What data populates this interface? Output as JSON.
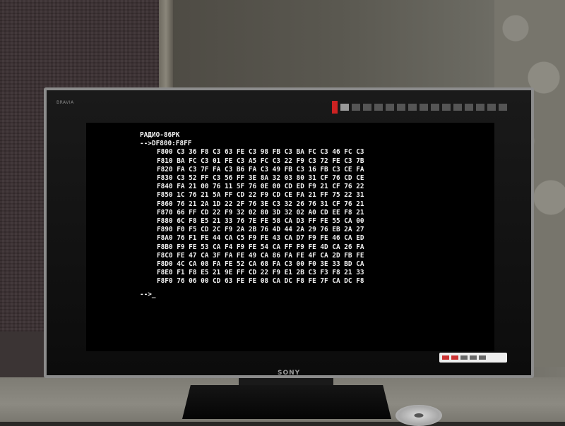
{
  "tv": {
    "brand_bezel": "BRAVIA",
    "logo": "SONY"
  },
  "terminal": {
    "title": "РАДИО-86РК",
    "command": "-->DF800:F8FF",
    "rows": [
      "F800 C3 36 F8 C3 63 FE C3 98 FB C3 BA FC C3 46 FC C3",
      "F810 BA FC C3 01 FE C3 A5 FC C3 22 F9 C3 72 FE C3 7B",
      "F820 FA C3 7F FA C3 B6 FA C3 49 FB C3 16 FB C3 CE FA",
      "F830 C3 52 FF C3 56 FF 3E 8A 32 03 80 31 CF 76 CD CE",
      "F840 FA 21 00 76 11 5F 76 0E 00 CD ED F9 21 CF 76 22",
      "F850 1C 76 21 5A FF CD 22 F9 CD CE FA 21 FF 75 22 31",
      "F860 76 21 2A 1D 22 2F 76 3E C3 32 26 76 31 CF 76 21",
      "F870 66 FF CD 22 F9 32 02 80 3D 32 02 A0 CD EE F8 21",
      "F880 6C F8 E5 21 33 76 7E FE 58 CA D3 FF FE 55 CA 00",
      "F890 F0 F5 CD 2C F9 2A 2B 76 4D 44 2A 29 76 EB 2A 27",
      "F8A0 76 F1 FE 44 CA C5 F9 FE 43 CA D7 F9 FE 46 CA ED",
      "F8B0 F9 FE 53 CA F4 F9 FE 54 CA FF F9 FE 4D CA 26 FA",
      "F8C0 FE 47 CA 3F FA FE 49 CA 86 FA FE 4F CA 2D FB FE",
      "F8D0 4C CA 08 FA FE 52 CA 68 FA C3 00 F0 3E 33 BD CA",
      "F8E0 F1 F8 E5 21 9E FF CD 22 F9 E1 2B C3 F3 F8 21 33",
      "F8F0 76 06 00 CD 63 FE FE 08 CA DC F8 FE 7F CA DC F8"
    ],
    "prompt": "-->_"
  }
}
